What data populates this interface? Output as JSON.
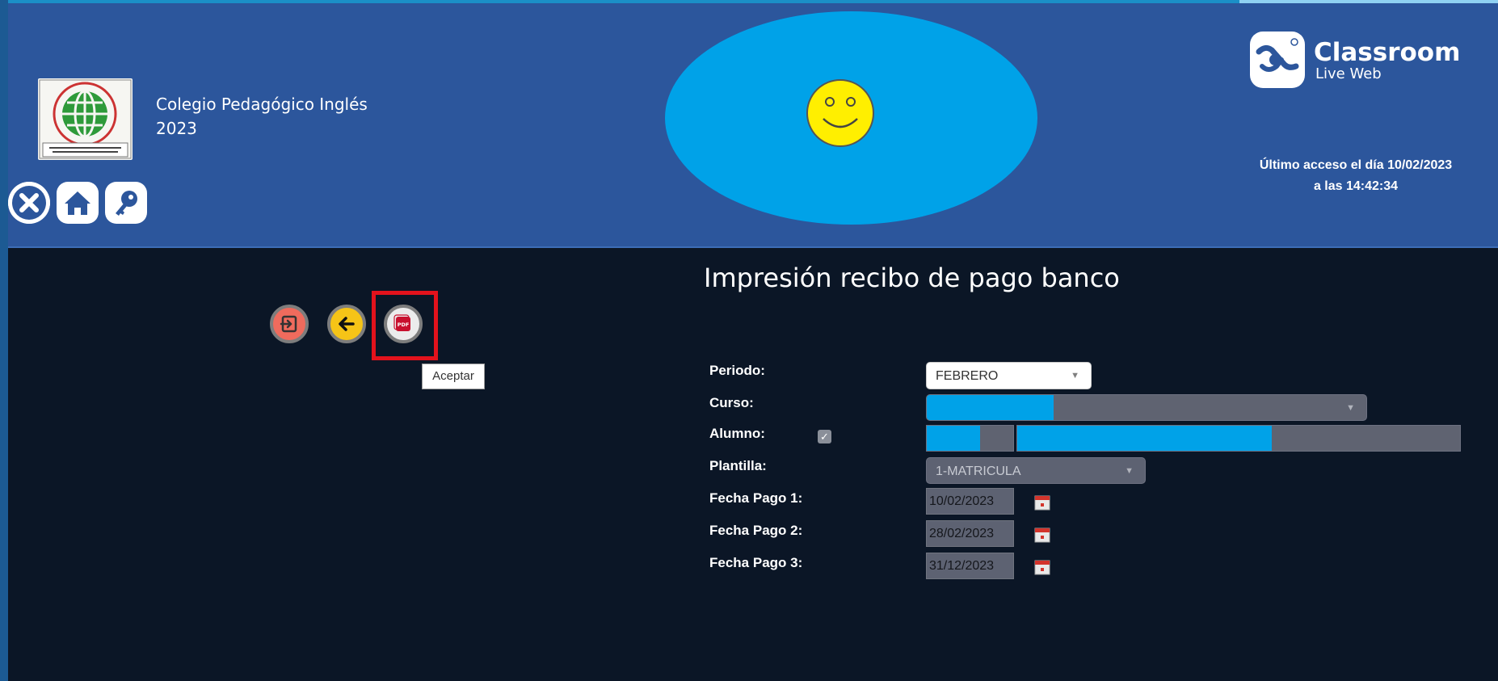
{
  "header": {
    "school_name": "Colegio Pedagógico Inglés",
    "school_year": "2023",
    "brand_title": "Classroom",
    "brand_subtitle": "Live Web",
    "last_access_line1": "Último acceso el día 10/02/2023",
    "last_access_line2": "a las 14:42:34",
    "nav_icons": [
      "close-icon",
      "home-icon",
      "key-icon"
    ]
  },
  "toolbar": {
    "buttons": [
      "exit-icon",
      "back-arrow-icon",
      "pdf-icon"
    ],
    "tooltip": "Aceptar"
  },
  "form": {
    "title": "Impresión recibo de pago banco",
    "periodo_label": "Periodo:",
    "periodo_value": "FEBRERO",
    "curso_label": "Curso:",
    "alumno_label": "Alumno:",
    "alumno_checked": true,
    "plantilla_label": "Plantilla:",
    "plantilla_value": "1-MATRICULA",
    "fecha1_label": "Fecha Pago 1:",
    "fecha1_value": "10/02/2023",
    "fecha2_label": "Fecha Pago 2:",
    "fecha2_value": "28/02/2023",
    "fecha3_label": "Fecha Pago 3:",
    "fecha3_value": "31/12/2023"
  },
  "colors": {
    "header_bg": "#2c569c",
    "page_bg": "#0b1626",
    "accent_blue": "#00a2e8",
    "highlight_red": "#e3121c"
  }
}
